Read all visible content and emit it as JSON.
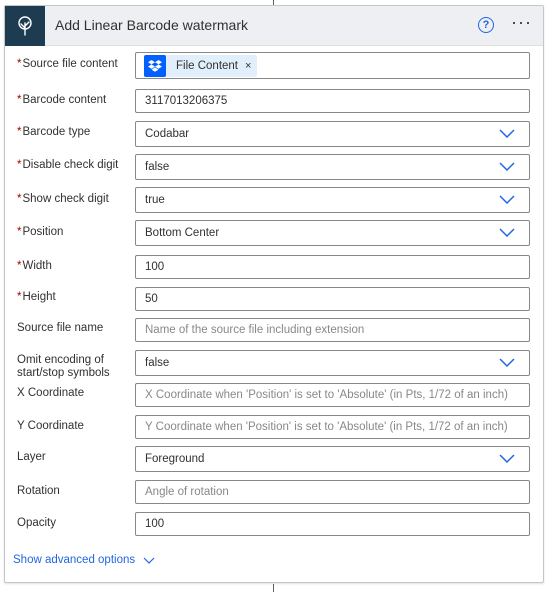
{
  "header": {
    "title": "Add Linear Barcode watermark",
    "help_icon": "question-circle-icon",
    "more_icon": "ellipsis-icon",
    "more_glyph": "···",
    "help_glyph": "?",
    "brand_color": "#1d3c52"
  },
  "fields": {
    "source_file_content": {
      "label": "Source file content",
      "required": "*",
      "token_label": "File Content",
      "token_icon": "dropbox-icon",
      "token_close": "×"
    },
    "barcode_content": {
      "label": "Barcode content",
      "required": "*",
      "value": "3117013206375"
    },
    "barcode_type": {
      "label": "Barcode type",
      "required": "*",
      "value": "Codabar"
    },
    "disable_check_digit": {
      "label": "Disable check digit",
      "required": "*",
      "value": "false"
    },
    "show_check_digit": {
      "label": "Show check digit",
      "required": "*",
      "value": "true"
    },
    "position": {
      "label": "Position",
      "required": "*",
      "value": "Bottom Center"
    },
    "width": {
      "label": "Width",
      "required": "*",
      "value": "100"
    },
    "height": {
      "label": "Height",
      "required": "*",
      "value": "50"
    },
    "source_file_name": {
      "label": "Source file name",
      "placeholder": "Name of the source file including extension"
    },
    "omit_encoding": {
      "label_line1": "Omit encoding of",
      "label_line2": "start/stop symbols",
      "value": "false"
    },
    "x_coordinate": {
      "label": "X Coordinate",
      "placeholder": "X Coordinate when 'Position' is set to 'Absolute' (in Pts, 1/72 of an inch)"
    },
    "y_coordinate": {
      "label": "Y Coordinate",
      "placeholder": "Y Coordinate when 'Position' is set to 'Absolute' (in Pts, 1/72 of an inch)"
    },
    "layer": {
      "label": "Layer",
      "value": "Foreground"
    },
    "rotation": {
      "label": "Rotation",
      "placeholder": "Angle of rotation"
    },
    "opacity": {
      "label": "Opacity",
      "value": "100"
    }
  },
  "footer": {
    "show_advanced_label": "Show advanced options"
  },
  "colors": {
    "required": "#a80000",
    "link": "#2266e3",
    "dropbox": "#0061fe",
    "token_bg": "#e1eefb"
  }
}
